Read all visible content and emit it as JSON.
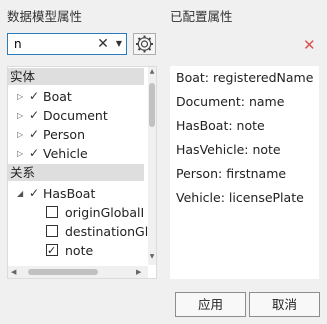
{
  "left_panel": {
    "title": "数据模型属性"
  },
  "right_panel": {
    "title": "已配置属性"
  },
  "search": {
    "value": "n",
    "clear_icon": "✕",
    "dropdown_icon": "▼"
  },
  "groups": {
    "entities": {
      "label": "实体",
      "items": [
        {
          "label": "Boat",
          "expanded": false,
          "checked": true
        },
        {
          "label": "Document",
          "expanded": false,
          "checked": true
        },
        {
          "label": "Person",
          "expanded": false,
          "checked": true
        },
        {
          "label": "Vehicle",
          "expanded": false,
          "checked": true
        }
      ]
    },
    "relationships": {
      "label": "关系",
      "items": [
        {
          "label": "HasBoat",
          "expanded": true,
          "checked": true,
          "children": [
            {
              "label": "originGlobalI",
              "checked": false
            },
            {
              "label": "destinationGl",
              "checked": false
            },
            {
              "label": "note",
              "checked": true
            }
          ]
        }
      ]
    }
  },
  "configured": [
    "Boat: registeredName",
    "Document: name",
    "HasBoat: note",
    "HasVehicle: note",
    "Person: firstname",
    "Vehicle: licensePlate"
  ],
  "buttons": {
    "apply": "应用",
    "cancel": "取消"
  },
  "colors": {
    "accent": "#2b7bbf",
    "remove": "#d9534f",
    "group_header": "#dedede"
  },
  "icons": {
    "expand_collapsed": "▷",
    "expand_open": "◢",
    "check": "✓",
    "remove": "✕"
  }
}
